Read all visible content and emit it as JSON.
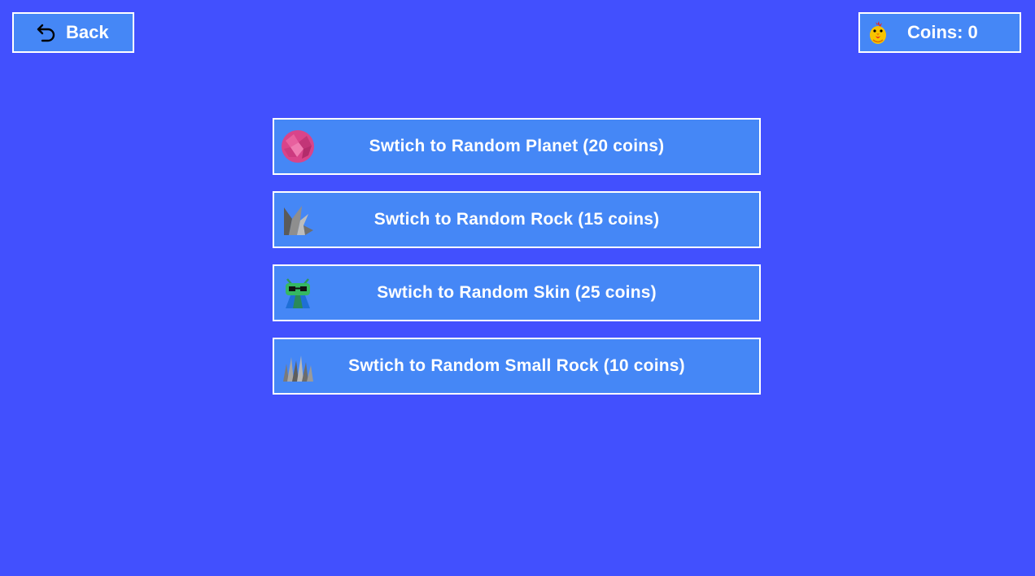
{
  "header": {
    "back_label": "Back",
    "back_icon": "undo-arrow-icon",
    "coins_label": "Coins: 0",
    "coins_icon": "chicken-icon"
  },
  "shop": {
    "items": [
      {
        "label": "Swtich to Random Planet (20 coins)",
        "icon": "pink-planet-icon"
      },
      {
        "label": "Swtich to Random Rock (15 coins)",
        "icon": "gray-rock-icon"
      },
      {
        "label": "Swtich to Random Skin (25 coins)",
        "icon": "alien-skin-icon"
      },
      {
        "label": "Swtich to Random Small Rock (10 coins)",
        "icon": "small-rocks-icon"
      }
    ]
  },
  "colors": {
    "background": "#4250fe",
    "button_fill": "#4587f6",
    "button_border": "#ffffff",
    "text": "#ffffff"
  }
}
